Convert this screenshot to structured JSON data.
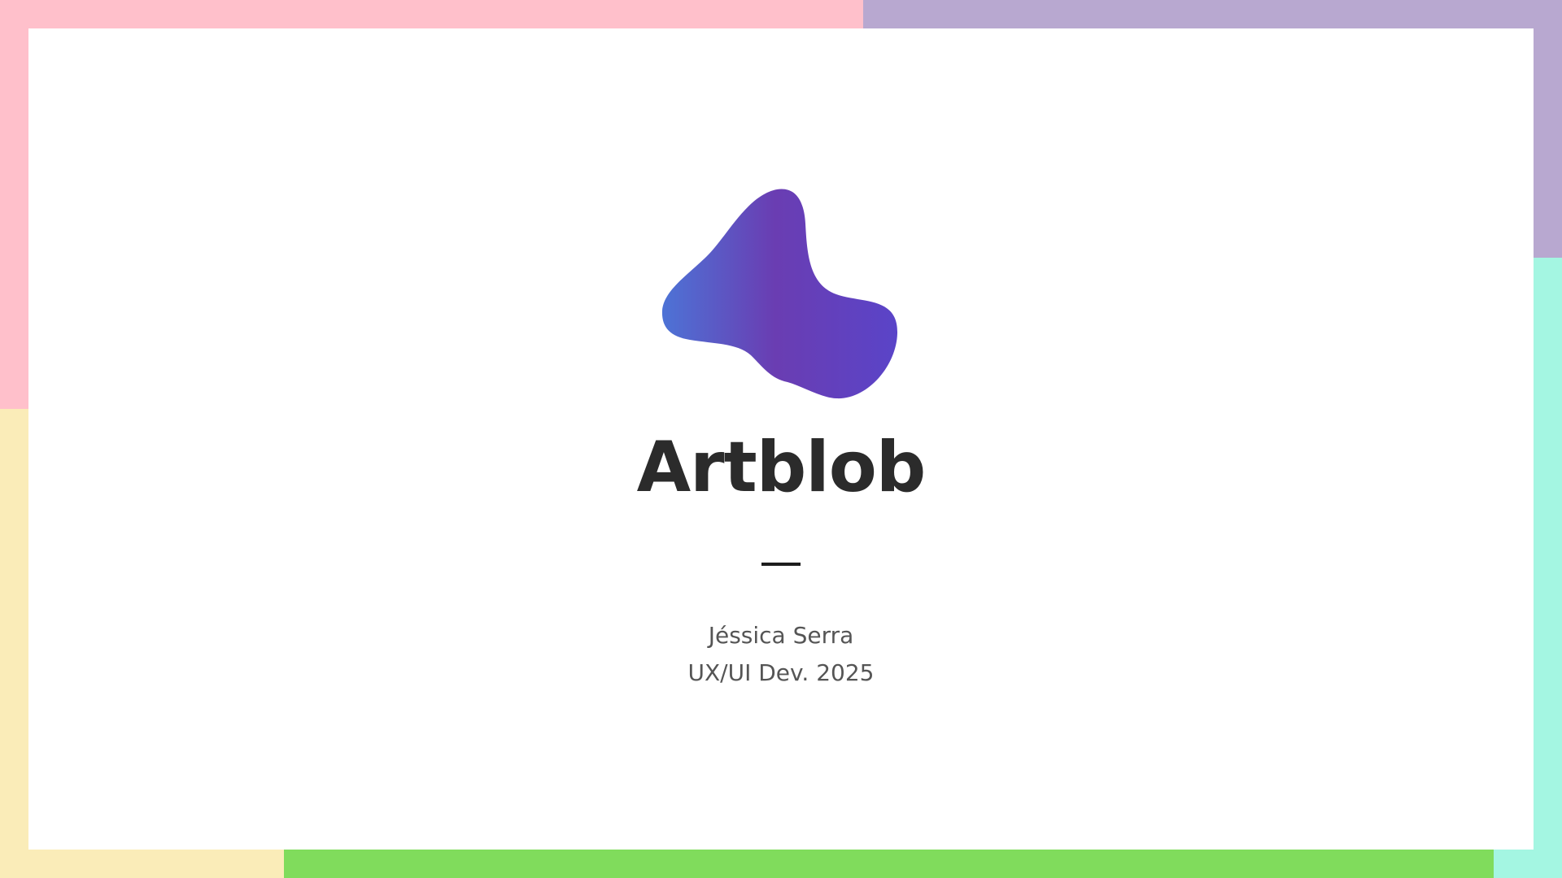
{
  "slide": {
    "title": "Artblob",
    "author": "Jéssica Serra",
    "course": "UX/UI Dev. 2025",
    "logo_icon": "blob-logo-icon"
  },
  "colors": {
    "pink": "#ffc0cb",
    "lavender": "#b8a8d0",
    "yellow": "#faecb8",
    "green": "#80dc5c",
    "mint": "#a4f6e2",
    "blob_gradient": [
      "#4d73d6",
      "#6a3db2",
      "#5a44c8"
    ],
    "title": "#2b2b2b",
    "subtitle": "#555555"
  }
}
